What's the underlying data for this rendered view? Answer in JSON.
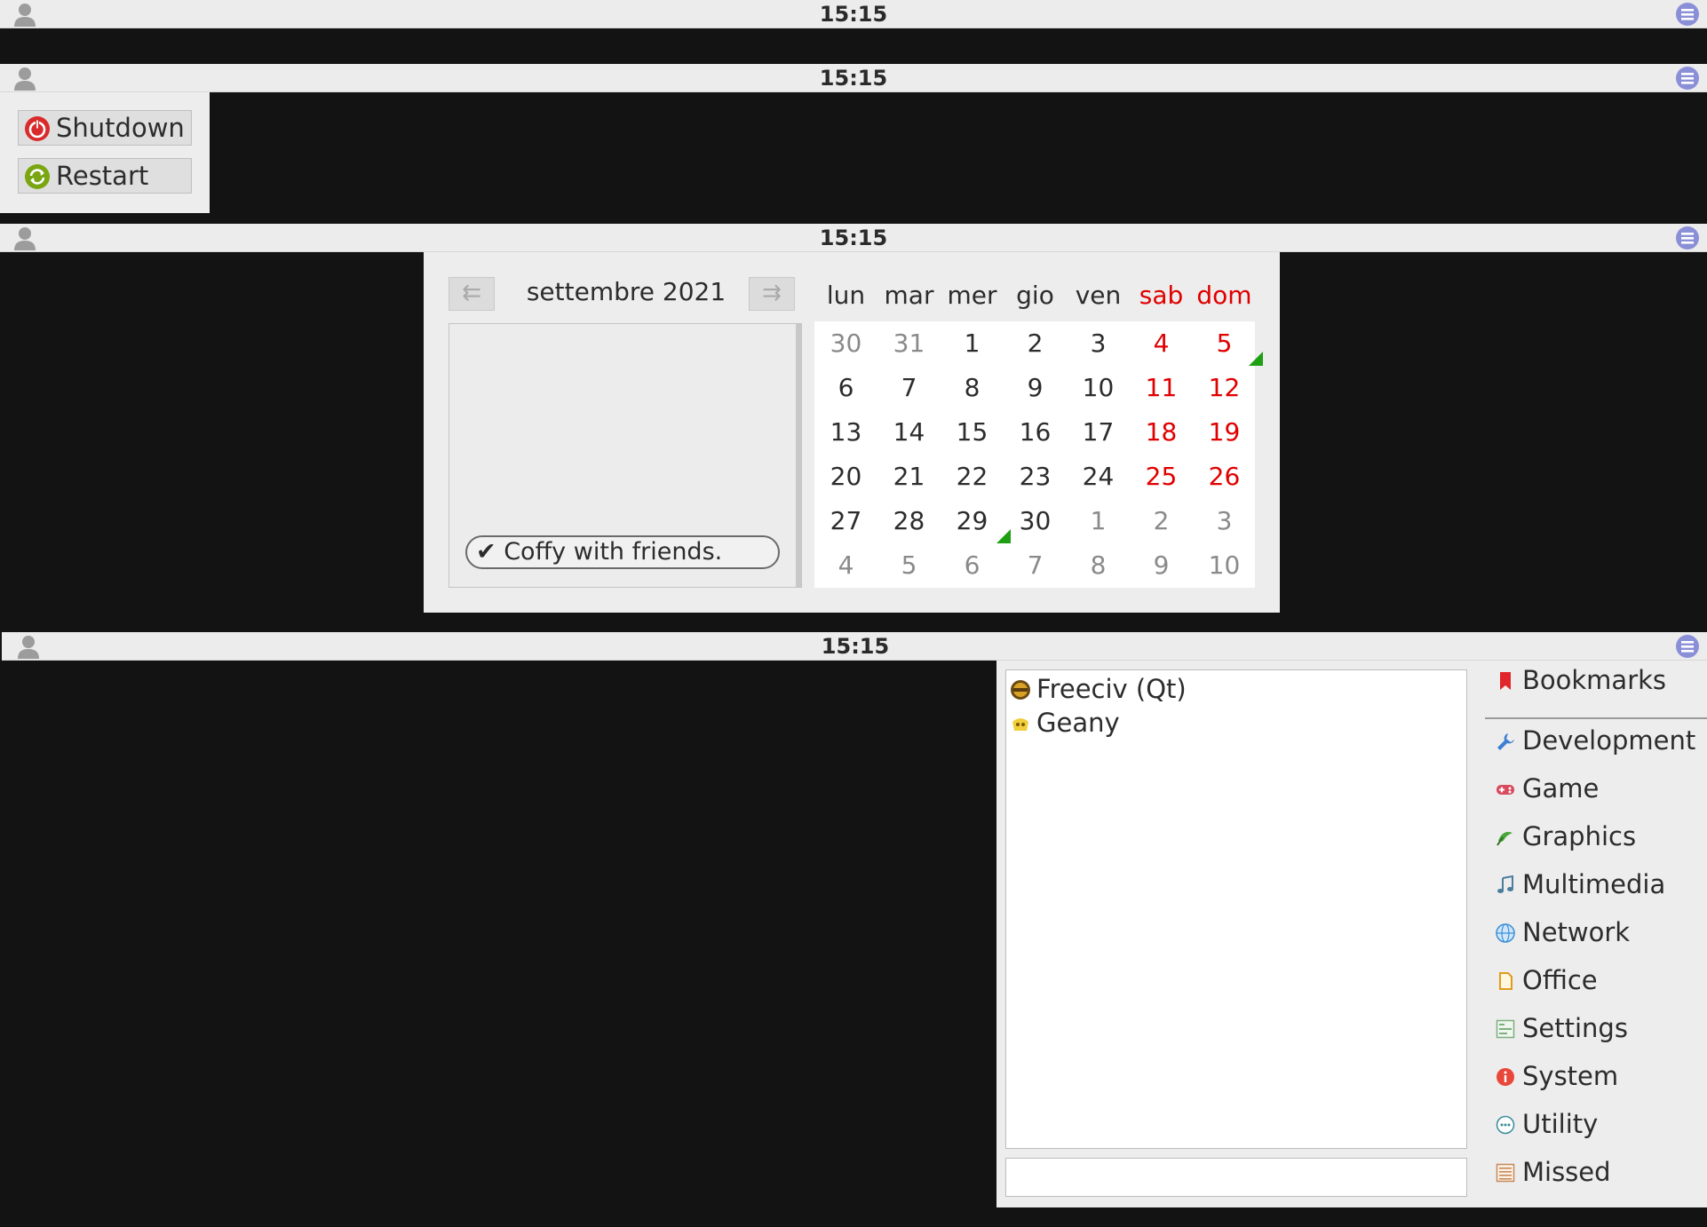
{
  "panels": [
    {
      "clock": "15:15"
    },
    {
      "clock": "15:15"
    },
    {
      "clock": "15:15"
    },
    {
      "clock": "15:15"
    }
  ],
  "session_menu": {
    "shutdown_label": "Shutdown",
    "restart_label": "Restart"
  },
  "calendar": {
    "month_label": "settembre 2021",
    "weekdays": [
      "lun",
      "mar",
      "mer",
      "gio",
      "ven",
      "sab",
      "dom"
    ],
    "weeks": [
      [
        "30",
        "31",
        "1",
        "2",
        "3",
        "4",
        "5"
      ],
      [
        "6",
        "7",
        "8",
        "9",
        "10",
        "11",
        "12"
      ],
      [
        "13",
        "14",
        "15",
        "16",
        "17",
        "18",
        "19"
      ],
      [
        "20",
        "21",
        "22",
        "23",
        "24",
        "25",
        "26"
      ],
      [
        "27",
        "28",
        "29",
        "30",
        "1",
        "2",
        "3"
      ],
      [
        "4",
        "5",
        "6",
        "7",
        "8",
        "9",
        "10"
      ]
    ],
    "event": "✔ Coffy with friends.",
    "colors": {
      "weekend": "#e00000",
      "other_month": "#8a8a8a",
      "event_marker": "#1fa012"
    }
  },
  "app_menu": {
    "apps": [
      {
        "name": "Freeciv (Qt)",
        "icon": "freeciv-icon"
      },
      {
        "name": "Geany",
        "icon": "geany-icon"
      }
    ],
    "search_value": "",
    "categories": [
      {
        "label": "Bookmarks",
        "icon": "bookmark-icon"
      },
      {
        "label": "Development",
        "icon": "wrench-icon"
      },
      {
        "label": "Game",
        "icon": "gamepad-icon"
      },
      {
        "label": "Graphics",
        "icon": "graphics-icon"
      },
      {
        "label": "Multimedia",
        "icon": "music-note-icon"
      },
      {
        "label": "Network",
        "icon": "globe-icon"
      },
      {
        "label": "Office",
        "icon": "document-icon"
      },
      {
        "label": "Settings",
        "icon": "settings-icon"
      },
      {
        "label": "System",
        "icon": "info-icon"
      },
      {
        "label": "Utility",
        "icon": "ellipsis-icon"
      },
      {
        "label": "Missed",
        "icon": "list-icon"
      }
    ]
  }
}
